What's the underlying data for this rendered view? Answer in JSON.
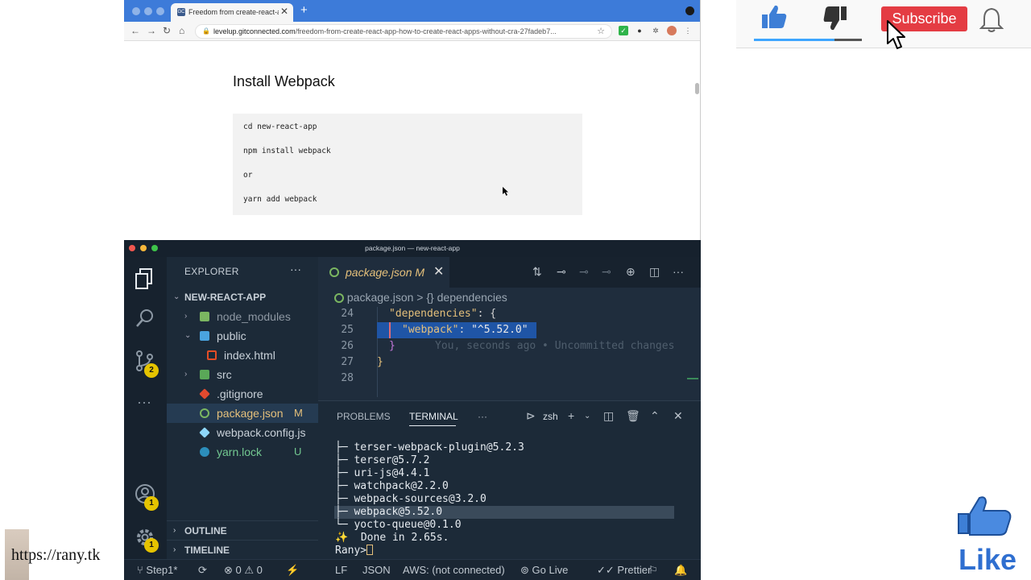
{
  "browser": {
    "tab_title": "Freedom from create-react-ap",
    "tab_favicon": "GC",
    "new_tab": "+",
    "close": "✕",
    "url_host": "levelup.gitconnected.com",
    "url_path": "/freedom-from-create-react-app-how-to-create-react-apps-without-cra-27fadeb7..."
  },
  "article": {
    "heading": "Install Webpack",
    "code_lines": [
      "cd new-react-app",
      "npm install webpack",
      "or",
      "yarn add webpack"
    ]
  },
  "youtube": {
    "subscribe_label": "Subscribe",
    "like_label": "Like",
    "accent": "#e43c43"
  },
  "vscode": {
    "window_title": "package.json — new-react-app",
    "explorer_label": "EXPLORER",
    "project": "NEW-REACT-APP",
    "scm_badge": "2",
    "account_badge": "1",
    "settings_badge": "1",
    "files": [
      {
        "label": "node_modules",
        "mark": ""
      },
      {
        "label": "public",
        "mark": ""
      },
      {
        "label": "index.html",
        "mark": ""
      },
      {
        "label": "src",
        "mark": ""
      },
      {
        "label": ".gitignore",
        "mark": ""
      },
      {
        "label": "package.json",
        "mark": "M"
      },
      {
        "label": "webpack.config.js",
        "mark": ""
      },
      {
        "label": "yarn.lock",
        "mark": "U"
      }
    ],
    "outline_label": "OUTLINE",
    "timeline_label": "TIMELINE",
    "active_tab": "package.json",
    "active_tab_mark": "M",
    "breadcrumb_file": "package.json",
    "breadcrumb_sep": ">",
    "breadcrumb_symbol": "{} dependencies",
    "line_numbers": [
      "24",
      "25",
      "26",
      "27",
      "28"
    ],
    "code": {
      "l24_key": "\"dependencies\"",
      "l24_rest": ": {",
      "l25_key": "\"webpack\"",
      "l25_colon": ": ",
      "l25_val": "\"^5.52.0\"",
      "l26": "}",
      "blame": "You, seconds ago • Uncommitted changes",
      "l27": "}"
    },
    "panel_tabs": {
      "problems": "PROBLEMS",
      "terminal": "TERMINAL",
      "more": "···"
    },
    "shell": "zsh",
    "terminal_lines": [
      "├─ terser-webpack-plugin@5.2.3",
      "├─ terser@5.7.2",
      "├─ uri-js@4.4.1",
      "├─ watchpack@2.2.0",
      "├─ webpack-sources@3.2.0",
      "├─ webpack@5.52.0",
      "└─ yocto-queue@0.1.0",
      "✨  Done in 2.65s.",
      "Rany>"
    ],
    "status": {
      "branch": "Step1*",
      "errors": "0",
      "warnings": "0",
      "eol": "LF",
      "language": "JSON",
      "aws": "AWS: (not connected)",
      "golive": "Go Live",
      "prettier": "Prettier"
    }
  },
  "watermark": "https://rany.tk"
}
